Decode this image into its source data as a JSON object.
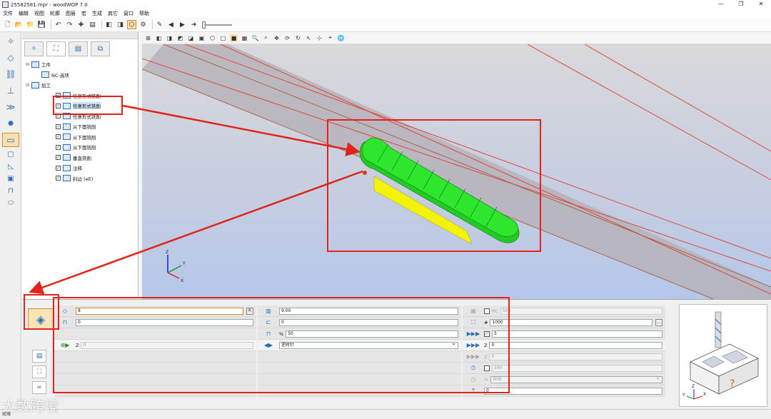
{
  "window": {
    "title": "25582581.mpr - woodWOP 7.0",
    "controls": [
      "—",
      "❐",
      "✕"
    ]
  },
  "menu": [
    "文件",
    "编辑",
    "视图",
    "轮廓",
    "图层",
    "宏",
    "生成",
    "其它",
    "窗口",
    "帮助"
  ],
  "tree": {
    "nodes": [
      {
        "label": "工件",
        "level": 0,
        "expand": "⊟",
        "check": false
      },
      {
        "label": "NC-选项",
        "level": 1,
        "expand": "",
        "check": false
      },
      {
        "label": "加工",
        "level": 0,
        "expand": "⊟",
        "check": false
      },
      {
        "label": "任意形式铣削",
        "level": 1,
        "expand": "",
        "check": true
      },
      {
        "label": "任意形式铣削",
        "level": 1,
        "expand": "",
        "check": true,
        "highlight": true
      },
      {
        "label": "任意形式铣削",
        "level": 1,
        "expand": "",
        "check": true
      },
      {
        "label": "从下面铣削",
        "level": 1,
        "expand": "",
        "check": true
      },
      {
        "label": "从下面铣削",
        "level": 1,
        "expand": "",
        "check": true
      },
      {
        "label": "从下面铣削",
        "level": 1,
        "expand": "",
        "check": true
      },
      {
        "label": "垂直铣削",
        "level": 1,
        "expand": "",
        "check": true
      },
      {
        "label": "注释",
        "level": 1,
        "expand": "",
        "check": true
      },
      {
        "label": "封边 (eE)",
        "level": 1,
        "expand": "",
        "check": true
      }
    ]
  },
  "axes": {
    "x": "X",
    "y": "Y",
    "z": "Z"
  },
  "params": {
    "col1": {
      "row1_value": "8",
      "row2_value": "0",
      "row4_label": "Z",
      "row4_value": "0"
    },
    "col2": {
      "row1_value": "9.00",
      "row2_value": "0",
      "row3_label": "%",
      "row3_value": "50",
      "row4_select": "逆时针"
    },
    "col3": {
      "row1_label": "RC",
      "row1_value": "500",
      "row2_label": "#",
      "row2_value": "1000",
      "row3_value": "5",
      "row4_label": "Z",
      "row4_value": "0",
      "row5_label": "Z",
      "row5_value": "0",
      "row6_value": "100",
      "row7_label": "%",
      "row7_value": "自动",
      "row8_value": "0"
    }
  },
  "status": "就绪",
  "watermark": "大数跨境",
  "colors": {
    "annotation": "#e2231a",
    "part_green": "#2ee62e",
    "part_yellow": "#f3f30a",
    "viewport_top": "#d9d9dc",
    "viewport_bottom": "#b5c7ea"
  }
}
